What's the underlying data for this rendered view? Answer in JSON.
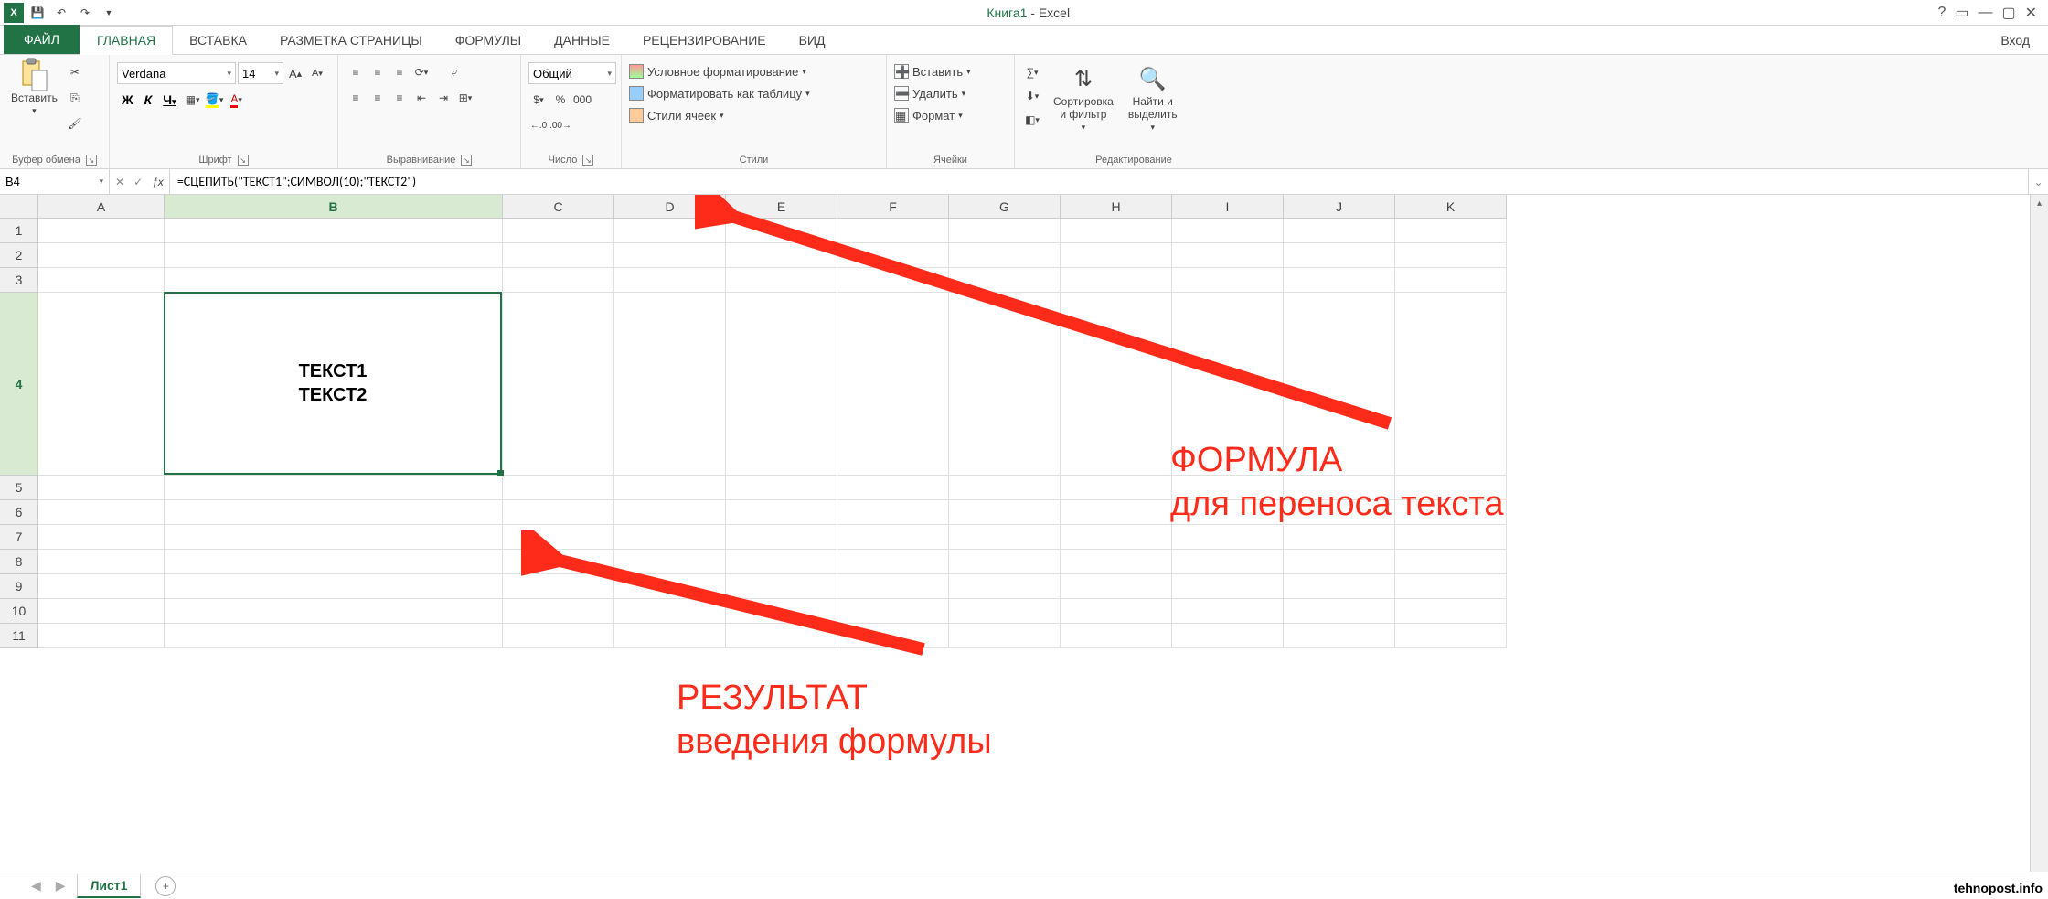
{
  "title": {
    "book": "Книга1",
    "suffix": " - Excel"
  },
  "login": "Вход",
  "tabs": {
    "file": "ФАЙЛ",
    "list": [
      "ГЛАВНАЯ",
      "ВСТАВКА",
      "РАЗМЕТКА СТРАНИЦЫ",
      "ФОРМУЛЫ",
      "ДАННЫЕ",
      "РЕЦЕНЗИРОВАНИЕ",
      "ВИД"
    ],
    "active_index": 0
  },
  "ribbon": {
    "clipboard": {
      "paste": "Вставить",
      "label": "Буфер обмена"
    },
    "font": {
      "name": "Verdana",
      "size": "14",
      "bold": "Ж",
      "italic": "К",
      "underline": "Ч",
      "label": "Шрифт"
    },
    "alignment": {
      "label": "Выравнивание"
    },
    "number": {
      "format": "Общий",
      "label": "Число"
    },
    "styles": {
      "cond": "Условное форматирование",
      "table": "Форматировать как таблицу",
      "cell": "Стили ячеек",
      "label": "Стили"
    },
    "cells": {
      "insert": "Вставить",
      "delete": "Удалить",
      "format": "Формат",
      "label": "Ячейки"
    },
    "editing": {
      "sort": "Сортировка\nи фильтр",
      "find": "Найти и\nвыделить",
      "label": "Редактирование"
    }
  },
  "name_box": "B4",
  "formula": "=СЦЕПИТЬ(\"ТЕКСТ1\";СИМВОЛ(10);\"ТЕКСТ2\")",
  "columns": [
    "A",
    "B",
    "C",
    "D",
    "E",
    "F",
    "G",
    "H",
    "I",
    "J",
    "K"
  ],
  "col_widths": {
    "A": 138,
    "B": 370,
    "default": 122
  },
  "rows": [
    1,
    2,
    3,
    4,
    5,
    6,
    7,
    8,
    9,
    10,
    11
  ],
  "row_heights": {
    "4": 200,
    "default": 27
  },
  "active_row": 4,
  "active_col": "B",
  "cell_value_line1": "ТЕКСТ1",
  "cell_value_line2": "ТЕКСТ2",
  "sheet_tab": "Лист1",
  "annotations": {
    "formula_title": "ФОРМУЛА",
    "formula_sub": "для переноса текста",
    "result_title": "РЕЗУЛЬТАТ",
    "result_sub": "введения формулы"
  },
  "watermark": "tehnopost.info"
}
